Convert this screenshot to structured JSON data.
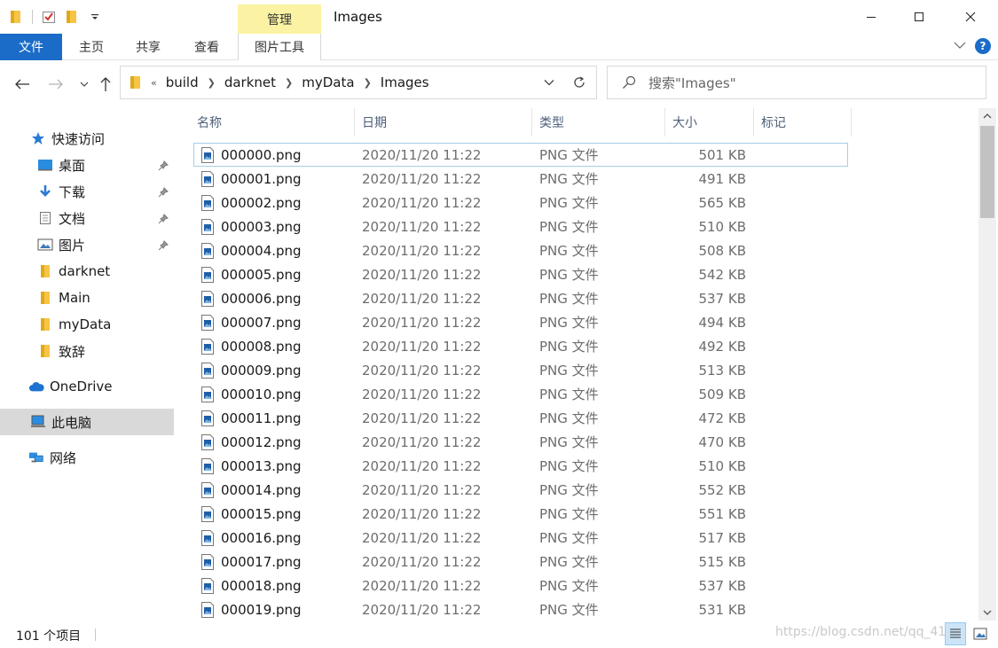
{
  "window": {
    "title": "Images",
    "context_tab": "管理",
    "controls": {
      "minimize": "—",
      "maximize": "☐",
      "close": "✕"
    }
  },
  "ribbon": {
    "tabs": {
      "file": "文件",
      "home": "主页",
      "share": "共享",
      "view": "查看",
      "picture_tools": "图片工具"
    },
    "help": "?"
  },
  "address": {
    "overflow": "«",
    "crumbs": [
      "build",
      "darknet",
      "myData",
      "Images"
    ]
  },
  "search": {
    "placeholder": "搜索\"Images\""
  },
  "sidebar": {
    "quick_access": "快速访问",
    "items": [
      {
        "label": "桌面",
        "icon": "desktop-icon",
        "pinned": true
      },
      {
        "label": "下载",
        "icon": "download-icon",
        "pinned": true
      },
      {
        "label": "文档",
        "icon": "document-icon",
        "pinned": true
      },
      {
        "label": "图片",
        "icon": "picture-icon",
        "pinned": true
      },
      {
        "label": "darknet",
        "icon": "folder-icon",
        "pinned": false
      },
      {
        "label": "Main",
        "icon": "folder-icon",
        "pinned": false
      },
      {
        "label": "myData",
        "icon": "folder-icon",
        "pinned": false
      },
      {
        "label": "致辞",
        "icon": "folder-icon",
        "pinned": false
      }
    ],
    "onedrive": "OneDrive",
    "this_pc": "此电脑",
    "network": "网络"
  },
  "columns": {
    "name": "名称",
    "date": "日期",
    "type": "类型",
    "size": "大小",
    "tags": "标记"
  },
  "files": [
    {
      "name": "000000.png",
      "date": "2020/11/20 11:22",
      "type": "PNG 文件",
      "size": "501 KB"
    },
    {
      "name": "000001.png",
      "date": "2020/11/20 11:22",
      "type": "PNG 文件",
      "size": "491 KB"
    },
    {
      "name": "000002.png",
      "date": "2020/11/20 11:22",
      "type": "PNG 文件",
      "size": "565 KB"
    },
    {
      "name": "000003.png",
      "date": "2020/11/20 11:22",
      "type": "PNG 文件",
      "size": "510 KB"
    },
    {
      "name": "000004.png",
      "date": "2020/11/20 11:22",
      "type": "PNG 文件",
      "size": "508 KB"
    },
    {
      "name": "000005.png",
      "date": "2020/11/20 11:22",
      "type": "PNG 文件",
      "size": "542 KB"
    },
    {
      "name": "000006.png",
      "date": "2020/11/20 11:22",
      "type": "PNG 文件",
      "size": "537 KB"
    },
    {
      "name": "000007.png",
      "date": "2020/11/20 11:22",
      "type": "PNG 文件",
      "size": "494 KB"
    },
    {
      "name": "000008.png",
      "date": "2020/11/20 11:22",
      "type": "PNG 文件",
      "size": "492 KB"
    },
    {
      "name": "000009.png",
      "date": "2020/11/20 11:22",
      "type": "PNG 文件",
      "size": "513 KB"
    },
    {
      "name": "000010.png",
      "date": "2020/11/20 11:22",
      "type": "PNG 文件",
      "size": "509 KB"
    },
    {
      "name": "000011.png",
      "date": "2020/11/20 11:22",
      "type": "PNG 文件",
      "size": "472 KB"
    },
    {
      "name": "000012.png",
      "date": "2020/11/20 11:22",
      "type": "PNG 文件",
      "size": "470 KB"
    },
    {
      "name": "000013.png",
      "date": "2020/11/20 11:22",
      "type": "PNG 文件",
      "size": "510 KB"
    },
    {
      "name": "000014.png",
      "date": "2020/11/20 11:22",
      "type": "PNG 文件",
      "size": "552 KB"
    },
    {
      "name": "000015.png",
      "date": "2020/11/20 11:22",
      "type": "PNG 文件",
      "size": "551 KB"
    },
    {
      "name": "000016.png",
      "date": "2020/11/20 11:22",
      "type": "PNG 文件",
      "size": "517 KB"
    },
    {
      "name": "000017.png",
      "date": "2020/11/20 11:22",
      "type": "PNG 文件",
      "size": "515 KB"
    },
    {
      "name": "000018.png",
      "date": "2020/11/20 11:22",
      "type": "PNG 文件",
      "size": "537 KB"
    },
    {
      "name": "000019.png",
      "date": "2020/11/20 11:22",
      "type": "PNG 文件",
      "size": "531 KB"
    }
  ],
  "status": {
    "count": "101 个项目",
    "watermark": "https://blog.csdn.net/qq_41"
  },
  "colors": {
    "accent": "#1a6cc8",
    "context_tab": "#fbf3a3",
    "folder": "#f6c545",
    "selection": "#d9d9d9",
    "focus_border": "#a3cee8"
  }
}
